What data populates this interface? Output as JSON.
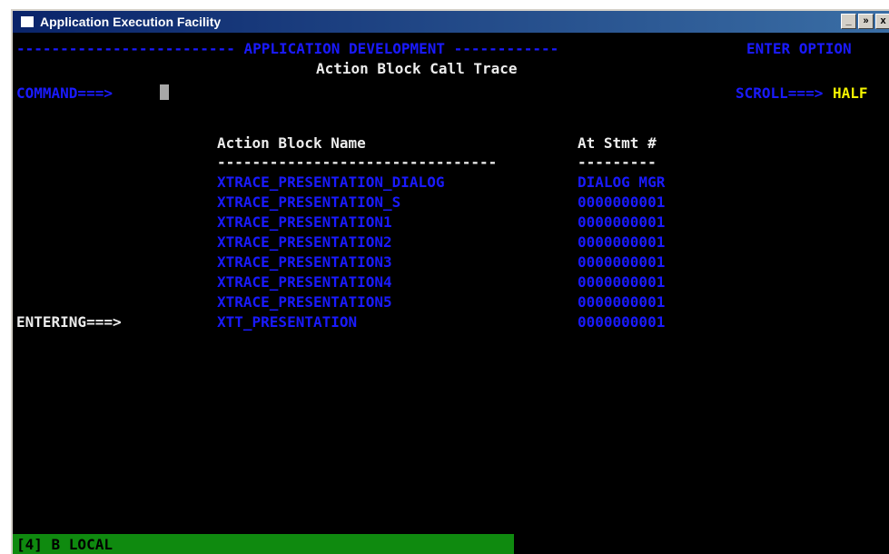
{
  "window": {
    "title": "Application Execution Facility",
    "controls": [
      "_",
      "»",
      "x"
    ]
  },
  "header": {
    "banner_left": "------------------------- APPLICATION DEVELOPMENT ------------",
    "banner_right": "ENTER OPTION",
    "subtitle": "Action Block Call Trace"
  },
  "command": {
    "label": "COMMAND===>",
    "value": ""
  },
  "scroll": {
    "label": "SCROLL===>",
    "value": "HALF"
  },
  "table": {
    "columns": [
      "Action Block Name",
      "At Stmt #"
    ],
    "underline_name": "--------------------------------",
    "underline_stmt": "---------",
    "rows": [
      {
        "name": "XTRACE_PRESENTATION_DIALOG",
        "stmt": "DIALOG MGR"
      },
      {
        "name": "XTRACE_PRESENTATION_S",
        "stmt": "0000000001"
      },
      {
        "name": "XTRACE_PRESENTATION1",
        "stmt": "0000000001"
      },
      {
        "name": "XTRACE_PRESENTATION2",
        "stmt": "0000000001"
      },
      {
        "name": "XTRACE_PRESENTATION3",
        "stmt": "0000000001"
      },
      {
        "name": "XTRACE_PRESENTATION4",
        "stmt": "0000000001"
      },
      {
        "name": "XTRACE_PRESENTATION5",
        "stmt": "0000000001"
      },
      {
        "name": "XTT_PRESENTATION",
        "stmt": "0000000001"
      }
    ]
  },
  "entering_label": "ENTERING===>",
  "status_bar": "[4] B LOCAL",
  "colors": {
    "background": "#000000",
    "field_blue": "#1a1aff",
    "text_white": "#ececec",
    "accent_yellow": "#f4f400",
    "status_green": "#0f8a0f"
  }
}
